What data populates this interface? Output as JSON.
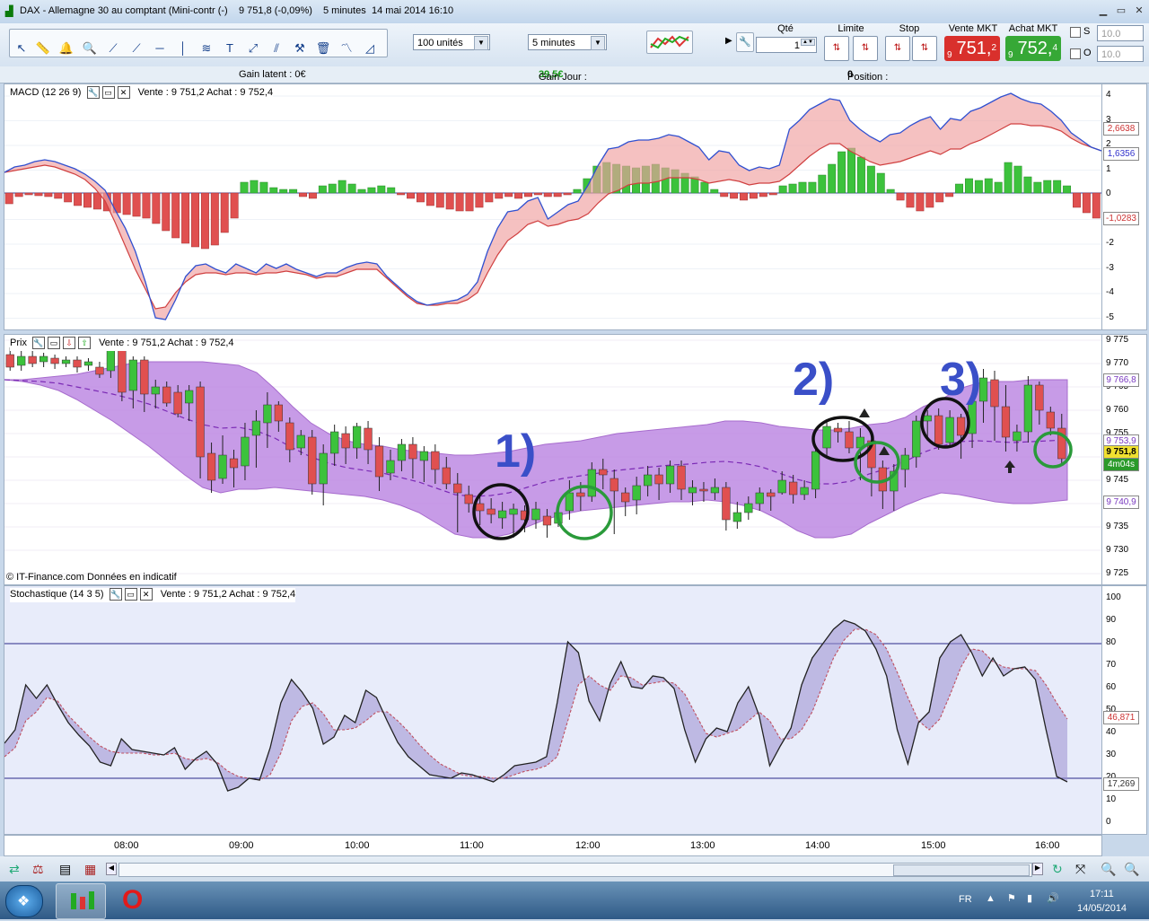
{
  "window": {
    "title": "DAX - Allemagne 30 au comptant (Mini-contr (-)",
    "price": "9 751,8 (-0,09%)",
    "interval": "5 minutes",
    "datetime": "14 mai 2014 16:10"
  },
  "toolbar": {
    "units_select": "100 unités",
    "period_select": "5 minutes",
    "qty_label": "Qté",
    "qty_value": "1",
    "limit_label": "Limite",
    "stop_label": "Stop",
    "sell_label": "Vente MKT",
    "buy_label": "Achat MKT",
    "sell_price": {
      "small": "9",
      "main": "751,",
      "sup": "2"
    },
    "buy_price": {
      "small": "9",
      "main": "752,",
      "sup": "4"
    },
    "s_label": "S",
    "o_label": "O",
    "s_value": "10.0",
    "o_value": "10.0"
  },
  "gains": {
    "latent": "Gain latent : 0€",
    "jour_label": "Gain Jour : ",
    "jour_value": "39,5€",
    "position_label": "Position : ",
    "position_value": "0"
  },
  "macd": {
    "title": "MACD (12 26 9)",
    "quote": "Vente : 9 751,2 Achat : 9 752,4",
    "ticks": [
      "4",
      "3",
      "2",
      "1",
      "0",
      "-1",
      "-2",
      "-3",
      "-4",
      "-5"
    ],
    "tag1": "2,6638",
    "tag2": "1,6356",
    "tag3": "-1,0283"
  },
  "price": {
    "title": "Prix",
    "quote": "Vente : 9 751,2 Achat : 9 752,4",
    "ticks": [
      "9 775",
      "9 770",
      "9 765",
      "9 760",
      "9 755",
      "9 750",
      "9 745",
      "9 740",
      "9 735",
      "9 730",
      "9 725"
    ],
    "tag_upper": "9 766,8",
    "tag_mid": "9 753,9",
    "tag_last": "9 751,8",
    "tag_timer": "4m04s",
    "tag_lower": "9 740,9",
    "annotations": [
      "1)",
      "2)",
      "3)"
    ],
    "credit": "© IT-Finance.com  Données en indicatif"
  },
  "stoch": {
    "title": "Stochastique (14 3 5)",
    "quote": "Vente : 9 751,2 Achat : 9 752,4",
    "ticks": [
      "100",
      "90",
      "80",
      "70",
      "60",
      "50",
      "40",
      "30",
      "20",
      "10",
      "0"
    ],
    "tag1": "46,871",
    "tag2": "17,269"
  },
  "time_axis": [
    "08:00",
    "09:00",
    "10:00",
    "11:00",
    "12:00",
    "13:00",
    "14:00",
    "15:00",
    "16:00"
  ],
  "taskbar": {
    "lang": "FR",
    "time": "17:11",
    "date": "14/05/2014"
  },
  "colors": {
    "up": "#2db92d",
    "down": "#e05050",
    "band": "#b57ae0",
    "annot_num": "#3a4fc8"
  }
}
